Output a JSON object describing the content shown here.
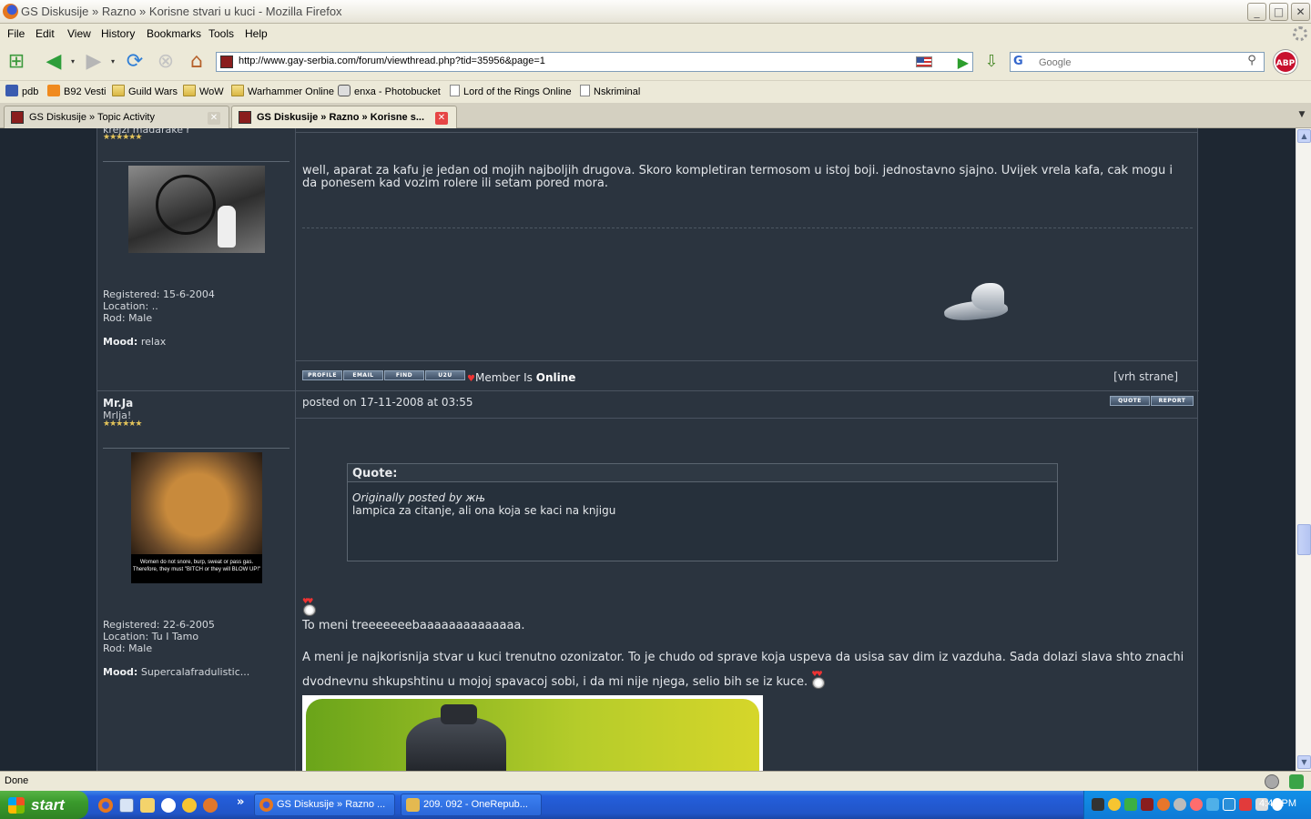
{
  "window": {
    "title": "GS Diskusije » Razno » Korisne stvari u kuci - Mozilla Firefox",
    "minimize": "_",
    "maximize": "□",
    "close": "✕"
  },
  "menu": [
    "File",
    "Edit",
    "View",
    "History",
    "Bookmarks",
    "Tools",
    "Help"
  ],
  "nav": {
    "url": "http://www.gay-serbia.com/forum/viewthread.php?tid=35956&page=1",
    "search_engine": "G",
    "search_placeholder": "Google",
    "adblock": "ABP"
  },
  "bookmarks": [
    {
      "label": "pdb",
      "icon": "pdb-icon"
    },
    {
      "label": "B92 Vesti",
      "icon": "rss-icon"
    },
    {
      "label": "Guild Wars",
      "icon": "folder-icon"
    },
    {
      "label": "WoW",
      "icon": "folder-icon"
    },
    {
      "label": "Warhammer Online",
      "icon": "folder-icon"
    },
    {
      "label": "enxa - Photobucket",
      "icon": "photo-icon"
    },
    {
      "label": "Lord of the Rings Online",
      "icon": "page-icon"
    },
    {
      "label": "Nskriminal",
      "icon": "page-icon"
    }
  ],
  "tabs": [
    {
      "label": "GS Diskusije » Topic Activity",
      "active": false
    },
    {
      "label": "GS Diskusije » Razno » Korisne s...",
      "active": true
    }
  ],
  "posts": {
    "first": {
      "user_sub": "krejzi madarake r",
      "stars": "★★★★★★",
      "registered": "Registered: 15-6-2004",
      "location": "Location: ..",
      "rod": "Rod: Male",
      "mood_label": "Mood:",
      "mood_value": "relax",
      "text": "well, aparat za kafu je jedan od mojih najboljih drugova. Skoro kompletiran termosom u istoj boji. jednostavno sjajno. Uvijek vrela kafa, cak mogu i da ponesem kad vozim rolere ili setam pored mora.",
      "buttons": [
        "PROFILE",
        "EMAIL",
        "FIND",
        "U2U"
      ],
      "online_prefix": "Member Is",
      "online_status": "Online",
      "top_link": "[vrh strane]"
    },
    "second": {
      "username": "Mr.Ja",
      "user_sub": "Mrlja!",
      "stars": "★★★★★★",
      "avatar_caption": "Women do not snore, burp, sweat or pass gas. Therefore, they must \"BITCH or they will BLOW UP!\"",
      "registered": "Registered: 22-6-2005",
      "location": "Location: Tu I Tamo",
      "rod": "Rod: Male",
      "mood_label": "Mood:",
      "mood_value": "Supercalafradulistic...",
      "posted": "posted on 17-11-2008 at 03:55",
      "actions": [
        "QUOTE",
        "REPORT"
      ],
      "quote_header": "Quote:",
      "quote_author": "Originally posted by жњ",
      "quote_text": "lampica za citanje, ali ona koja se kaci na knjigu",
      "line1": "To meni treeeeeeebaaaaaaaaaaaaaa.",
      "line2": "A meni je najkorisnija stvar u kuci trenutno ozonizator. To je chudo od sprave koja uspeva da usisa sav dim iz vazduha. Sada dolazi slava shto znachi dvodnevnu shkupshtinu u mojoj spavacoj sobi, i da mi nije njega, selio bih se iz kuce."
    }
  },
  "status": {
    "text": "Done"
  },
  "taskbar": {
    "start": "start",
    "windows": [
      "GS Diskusije » Razno ...",
      "209. 092 - OneRepub..."
    ],
    "expand": "»",
    "clock": "4:43 PM"
  }
}
